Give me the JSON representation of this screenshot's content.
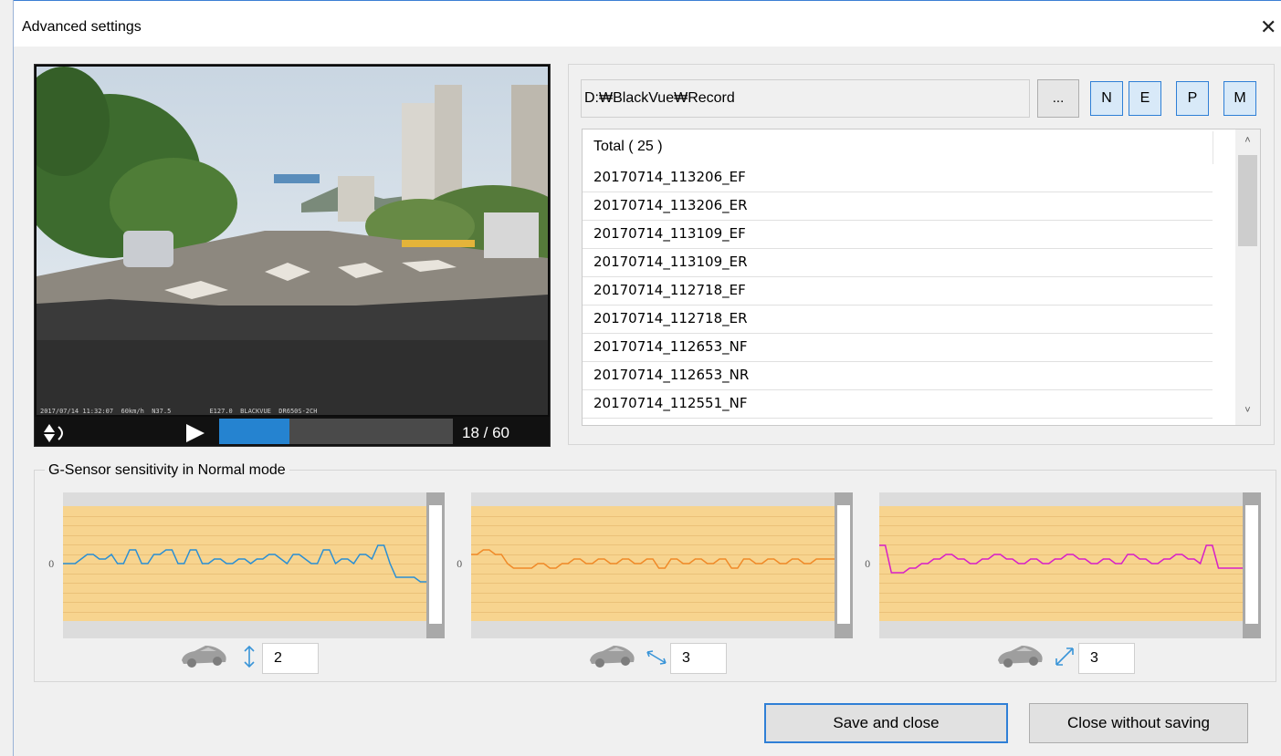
{
  "window": {
    "title": "Advanced settings",
    "close_glyph": "✕"
  },
  "video": {
    "osd_left": "2017/07/14 11:32:07  60km/h  N37.5",
    "osd_right": "E127.0  BLACKVUE  DR650S-2CH",
    "play_glyph": "▶",
    "frame_label": "18 / 60",
    "progress": 0.3,
    "icons": {
      "rotate": "rotate-icon",
      "play": "play-icon"
    }
  },
  "files": {
    "path": "D:₩BlackVue₩Record",
    "browse_label": "...",
    "filter_tabs": [
      "N",
      "E",
      "P",
      "M"
    ],
    "total_label": "Total ( 25 )",
    "items": [
      "20170714_113206_EF",
      "20170714_113206_ER",
      "20170714_113109_EF",
      "20170714_113109_ER",
      "20170714_112718_EF",
      "20170714_112718_ER",
      "20170714_112653_NF",
      "20170714_112653_NR",
      "20170714_112551_NF"
    ],
    "scroll_up_glyph": "˄",
    "scroll_down_glyph": "˅"
  },
  "gsensor": {
    "group_label": "G-Sensor sensitivity in Normal mode",
    "zero_label": "0",
    "graphs": [
      {
        "axis": "vertical",
        "color": "#2a8fd4",
        "value": "2",
        "icon": "vertical-arrow-icon"
      },
      {
        "axis": "front-back",
        "color": "#f08a28",
        "value": "3",
        "icon": "front-back-arrow-icon"
      },
      {
        "axis": "left-right",
        "color": "#d81ec8",
        "value": "3",
        "icon": "left-right-arrow-icon"
      }
    ]
  },
  "buttons": {
    "save": "Save and close",
    "cancel": "Close without saving"
  }
}
